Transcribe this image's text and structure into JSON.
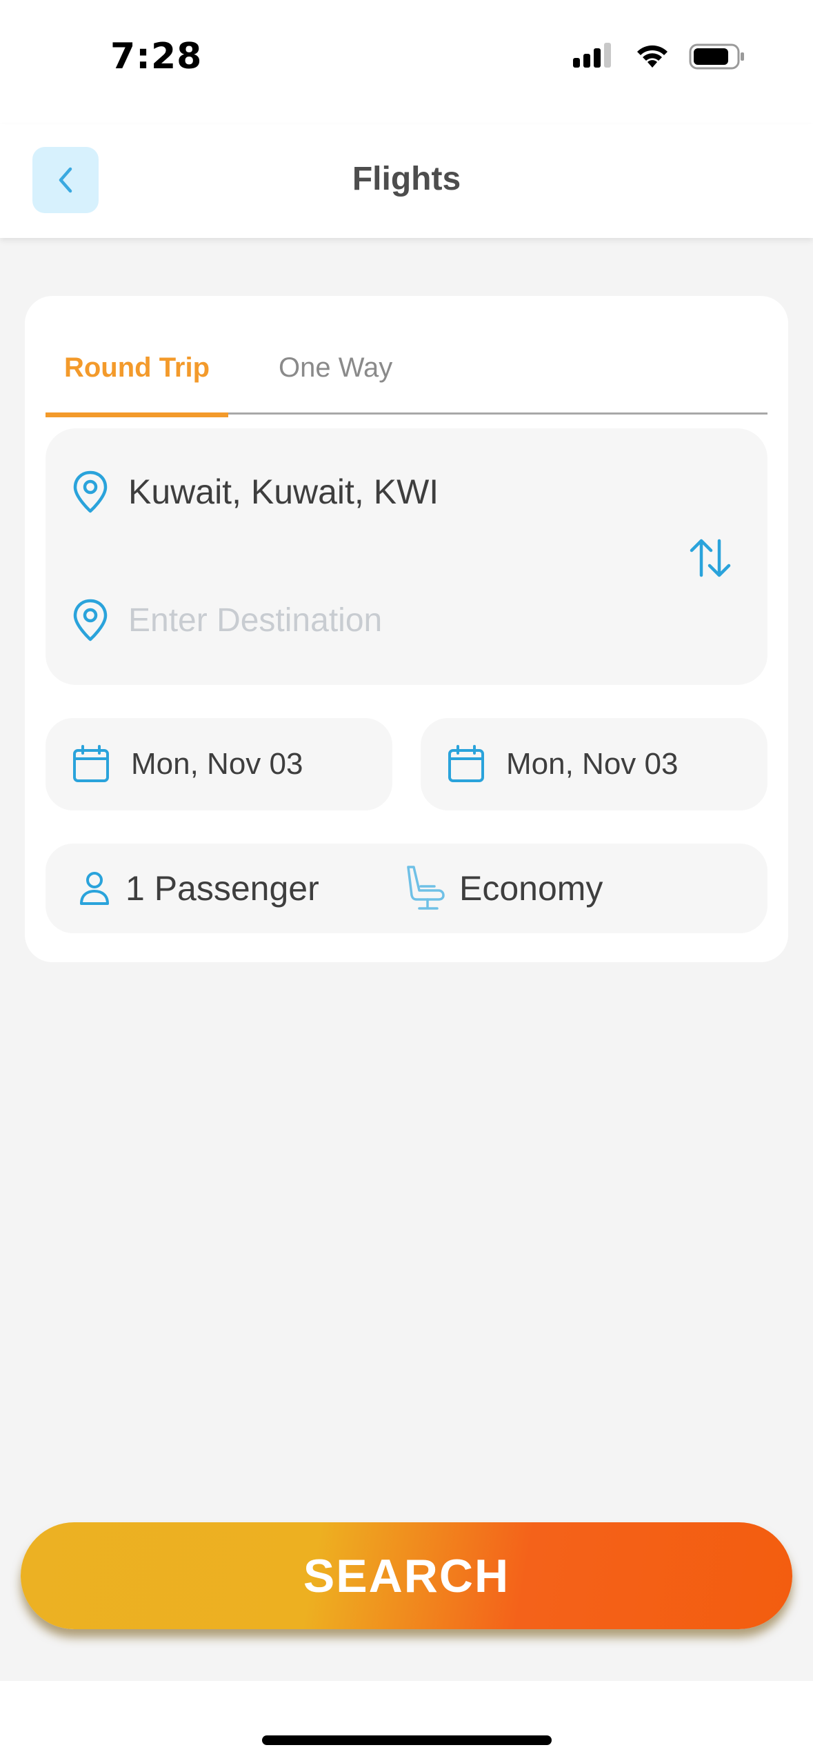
{
  "status_bar": {
    "time": "7:28"
  },
  "header": {
    "title": "Flights",
    "back_icon": "chevron-left-icon"
  },
  "tabs": [
    {
      "label": "Round Trip",
      "active": true
    },
    {
      "label": "One Way",
      "active": false
    }
  ],
  "route": {
    "origin": "Kuwait, Kuwait, KWI",
    "destination_value": "",
    "destination_placeholder": "Enter Destination",
    "pin_icon": "location-pin-icon",
    "swap_icon": "swap-vertical-icon"
  },
  "dates": {
    "depart": "Mon, Nov 03",
    "return": "Mon, Nov 03",
    "icon": "calendar-icon"
  },
  "travelers": {
    "passengers": "1 Passenger",
    "cabin_class": "Economy",
    "passenger_icon": "person-icon",
    "class_icon": "seat-icon"
  },
  "actions": {
    "search_label": "SEARCH"
  },
  "colors": {
    "accent_orange": "#f39a2b",
    "icon_blue": "#2aa3db",
    "back_button_bg": "#d7f1fd",
    "search_gradient_start": "#ecb123",
    "search_gradient_end": "#f35d0f"
  }
}
